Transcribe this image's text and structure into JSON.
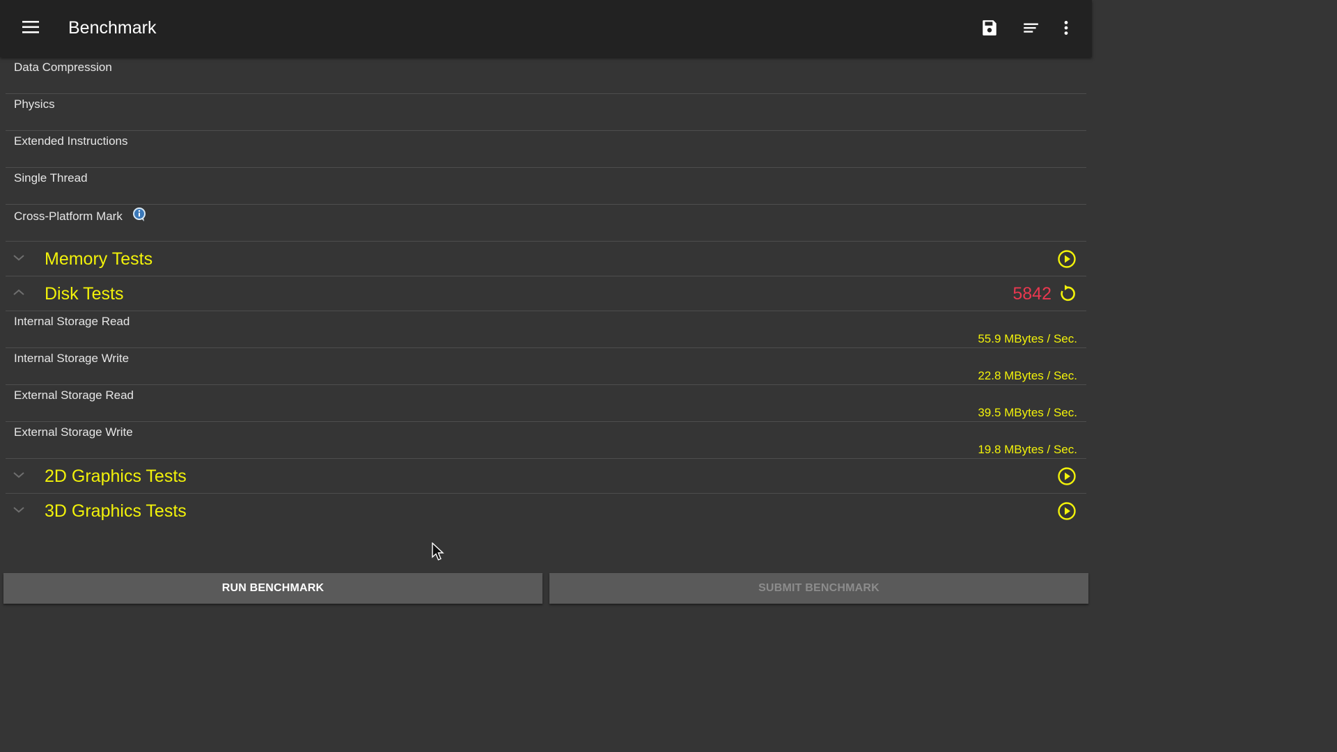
{
  "toolbar": {
    "title": "Benchmark",
    "icons": [
      "menu-icon",
      "save-icon",
      "sort-icon",
      "more-vert-icon"
    ]
  },
  "cpu_subtests": [
    {
      "label": "Data Compression"
    },
    {
      "label": "Physics"
    },
    {
      "label": "Extended Instructions"
    },
    {
      "label": "Single Thread"
    },
    {
      "label": "Cross-Platform Mark",
      "has_info": true
    }
  ],
  "groups": {
    "memory": {
      "label": "Memory Tests",
      "expanded": false
    },
    "disk": {
      "label": "Disk Tests",
      "expanded": true,
      "score": "5842",
      "subtests": [
        {
          "label": "Internal Storage Read",
          "value": "55.9 MBytes / Sec."
        },
        {
          "label": "Internal Storage Write",
          "value": "22.8 MBytes / Sec."
        },
        {
          "label": "External Storage Read",
          "value": "39.5 MBytes / Sec."
        },
        {
          "label": "External Storage Write",
          "value": "19.8 MBytes / Sec."
        }
      ]
    },
    "graphics2d": {
      "label": "2D Graphics Tests",
      "expanded": false
    },
    "graphics3d": {
      "label": "3D Graphics Tests",
      "expanded": false
    }
  },
  "buttons": {
    "run": "RUN BENCHMARK",
    "submit": "SUBMIT BENCHMARK"
  },
  "colors": {
    "accent_yellow": "#f2f20a",
    "score_red": "#e8384f",
    "toolbar_bg": "#222222",
    "content_bg": "#353535",
    "button_bg": "#5a5a5a"
  }
}
